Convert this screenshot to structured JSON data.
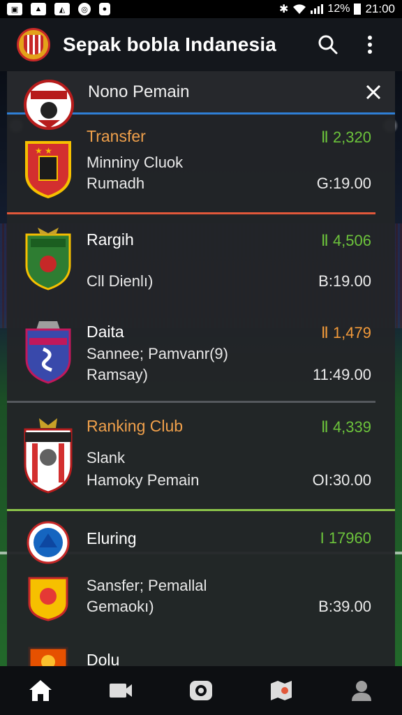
{
  "status_bar": {
    "battery": "12%",
    "time": "21:00",
    "icons": [
      "gallery-icon",
      "photo-icon",
      "photo-icon",
      "whatsapp-icon",
      "shield-icon"
    ]
  },
  "app_bar": {
    "title": "Sepak bobla Indanesia"
  },
  "panel": {
    "title": "Nono Pemain"
  },
  "rows": [
    {
      "name": "Transfer",
      "line1": "Minniny Cluok",
      "line2": "Rumadh",
      "stat": "Ⅱ 2,320",
      "value": "G:19.00"
    },
    {
      "name": "Rargih",
      "line1": "Cll Dienlı)",
      "stat": "Ⅱ 4,506",
      "value": "B:19.00"
    },
    {
      "name": "Daita",
      "line1": "Sannee; Pamvanr(9)",
      "line2": "Ramsay)",
      "stat": "Ⅱ 1,479",
      "value": "11:49.00"
    },
    {
      "name": "Ranking Club",
      "line1": "Slank",
      "line2": "Hamoky Pemain",
      "stat": "Ⅱ 4,339",
      "value": "OI:30.00"
    },
    {
      "name": "Eluring",
      "stat": "I 17960"
    },
    {
      "line1": "Sansfer; Pemallal",
      "line2": "Gemaokı)",
      "value": "B:39.00"
    },
    {
      "name": "Dolu"
    }
  ],
  "colors": {
    "accent_blue": "#2f7fd6",
    "accent_orange": "#e2583a",
    "stat_green": "#6cc33b",
    "name_orange": "#f0a04b",
    "panel_bg": "#222428"
  },
  "bottom_nav": [
    "home-icon",
    "video-icon",
    "camera-icon",
    "map-icon",
    "profile-icon"
  ]
}
